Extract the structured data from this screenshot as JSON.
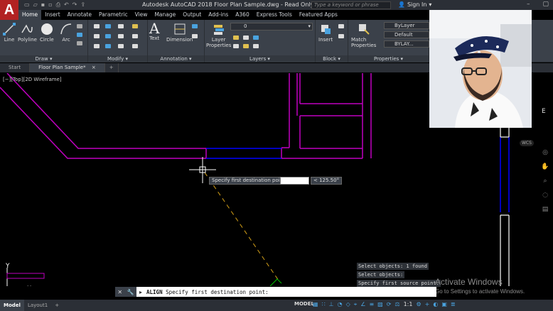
{
  "app": {
    "logo": "A",
    "title": "Autodesk AutoCAD 2018    Floor Plan Sample.dwg - Read Only",
    "search_placeholder": "Type a keyword or phrase",
    "signin": "Sign In",
    "qat_icons": [
      "new-icon",
      "open-icon",
      "save-icon",
      "saveas-icon",
      "print-icon",
      "undo-icon",
      "redo-icon"
    ]
  },
  "ribbon_tabs": [
    "Home",
    "Insert",
    "Annotate",
    "Parametric",
    "View",
    "Manage",
    "Output",
    "Add-ins",
    "A360",
    "Express Tools",
    "Featured Apps"
  ],
  "ribbon_active": "Home",
  "panels": {
    "draw": {
      "label": "Draw ▾",
      "tools": [
        "Line",
        "Polyline",
        "Circle",
        "Arc"
      ]
    },
    "modify": {
      "label": "Modify ▾"
    },
    "annotation": {
      "label": "Annotation ▾",
      "tools": [
        "Text",
        "Dimension"
      ]
    },
    "layers": {
      "label": "Layers ▾",
      "properties": "Layer\nProperties",
      "current_layer": "0"
    },
    "block": {
      "label": "Block ▾",
      "insert": "Insert"
    },
    "properties": {
      "label": "Properties ▾",
      "match": "Match\nProperties",
      "color": "ByLayer",
      "linetype": "Default",
      "lineweight": "BYLAY..."
    }
  },
  "file_tabs": [
    "Start",
    "Floor Plan Sample*"
  ],
  "file_tab_active": "Floor Plan Sample*",
  "viewport_label": "[−][Top][2D Wireframe]",
  "dynamic_prompt": "Specify first destination point:",
  "dynamic_angle": "< 125.50°",
  "command_history": [
    "Select objects: 1 found",
    "Select objects:",
    "Specify first source point:"
  ],
  "command_line": {
    "command": "ALIGN",
    "prompt": "Specify first destination point:"
  },
  "watermark": {
    "title": "Activate Windows",
    "subtitle": "Go to Settings to activate Windows."
  },
  "viewcube": "WCS",
  "compass_e": "E",
  "layout_tabs": [
    "Model",
    "Layout1"
  ],
  "layout_active": "Model",
  "status_model": "MODEL",
  "status_scale": "1:1",
  "colors": {
    "wall": "#c000c0",
    "blue": "#0000ff",
    "white": "#ffffff",
    "accent": "#b22222",
    "ribbon": "#3b414a"
  }
}
